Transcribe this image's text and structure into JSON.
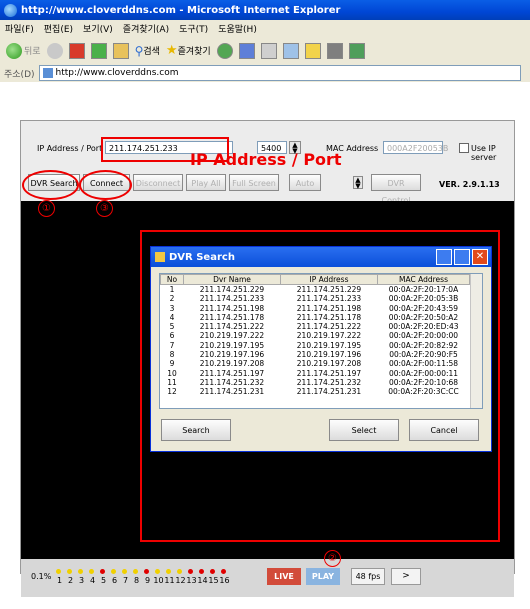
{
  "window": {
    "title": "http://www.cloverddns.com - Microsoft Internet Explorer"
  },
  "menu": [
    "파일(F)",
    "편집(E)",
    "보기(V)",
    "즐겨찾기(A)",
    "도구(T)",
    "도움말(H)"
  ],
  "toolbar": {
    "back_label": "뒤로",
    "search_label": "검색",
    "favorites_label": "즐겨찾기"
  },
  "address": {
    "label": "주소(D)",
    "url": "http://www.cloverddns.com"
  },
  "app": {
    "ip_label": "IP Address / Port",
    "ip_value": "211.174.251.233",
    "port_value": "5400",
    "mac_label": "MAC Address",
    "mac_value": "000A2F20053B",
    "use_ip_label": "Use IP server",
    "buttons": {
      "dvr_search": "DVR Search",
      "connect": "Connect",
      "disconnect": "Disconnect",
      "play_all": "Play All",
      "full_screen": "Full Screen",
      "auto": "Auto",
      "dvr_control": "DVR Control"
    },
    "version": "VER. 2.9.1.13",
    "annotation_title": "IP Address / Port",
    "callouts": {
      "one": "①",
      "two": "②",
      "three": "③"
    }
  },
  "dialog": {
    "title": "DVR Search",
    "columns": [
      "No",
      "Dvr Name",
      "IP Address",
      "MAC Address"
    ],
    "rows": [
      [
        "1",
        "211.174.251.229",
        "211.174.251.229",
        "00:0A:2F:20:17:0A"
      ],
      [
        "2",
        "211.174.251.233",
        "211.174.251.233",
        "00:0A:2F:20:05:3B"
      ],
      [
        "3",
        "211.174.251.198",
        "211.174.251.198",
        "00:0A:2F:20:43:59"
      ],
      [
        "4",
        "211.174.251.178",
        "211.174.251.178",
        "00:0A:2F:20:50:A2"
      ],
      [
        "5",
        "211.174.251.222",
        "211.174.251.222",
        "00:0A:2F:20:ED:43"
      ],
      [
        "6",
        "210.219.197.222",
        "210.219.197.222",
        "00:0A:2F:20:00:00"
      ],
      [
        "7",
        "210.219.197.195",
        "210.219.197.195",
        "00:0A:2F:20:82:92"
      ],
      [
        "8",
        "210.219.197.196",
        "210.219.197.196",
        "00:0A:2F:20:90:F5"
      ],
      [
        "9",
        "210.219.197.208",
        "210.219.197.208",
        "00:0A:2F:00:11:58"
      ],
      [
        "10",
        "211.174.251.197",
        "211.174.251.197",
        "00:0A:2F:00:00:11"
      ],
      [
        "11",
        "211.174.251.232",
        "211.174.251.232",
        "00:0A:2F:20:10:68"
      ],
      [
        "12",
        "211.174.251.231",
        "211.174.251.231",
        "00:0A:2F:20:3C:CC"
      ]
    ],
    "search_label": "Search",
    "select_label": "Select",
    "cancel_label": "Cancel"
  },
  "status": {
    "percent": "0.1%",
    "channels": [
      "1",
      "2",
      "3",
      "4",
      "5",
      "6",
      "7",
      "8",
      "9",
      "10",
      "11",
      "12",
      "13",
      "14",
      "15",
      "16"
    ],
    "channel_dot_colors": [
      "#f0d000",
      "#f0d000",
      "#f0d000",
      "#f0d000",
      "#e00000",
      "#f0d000",
      "#f0d000",
      "#f0d000",
      "#e00000",
      "#f0d000",
      "#f0d000",
      "#f0d000",
      "#e00000",
      "#e00000",
      "#e00000",
      "#e00000"
    ],
    "live_label": "LIVE",
    "play_label": "PLAY",
    "fps_label": "48 fps",
    "next_label": ">"
  }
}
